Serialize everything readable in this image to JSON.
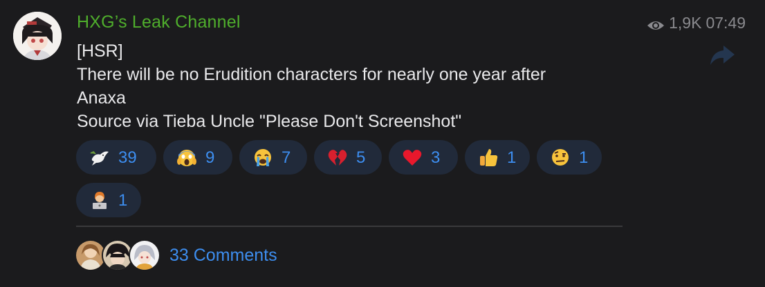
{
  "channel": {
    "name": "HXG’s Leak Channel",
    "views": "1,9K",
    "time": "07:49"
  },
  "message": {
    "lines": [
      "[HSR]",
      "There will be no Erudition characters for nearly one year after",
      "Anaxa",
      "Source via Tieba Uncle \"Please Don't Screenshot\""
    ]
  },
  "reactions": [
    {
      "icon": "dove-icon",
      "count": "39"
    },
    {
      "icon": "screaming-face-icon",
      "count": "9"
    },
    {
      "icon": "crying-face-icon",
      "count": "7"
    },
    {
      "icon": "broken-heart-icon",
      "count": "5"
    },
    {
      "icon": "red-heart-icon",
      "count": "3"
    },
    {
      "icon": "thumbs-up-icon",
      "count": "1"
    },
    {
      "icon": "raised-eyebrow-face-icon",
      "count": "1"
    },
    {
      "icon": "technologist-icon",
      "count": "1"
    }
  ],
  "comments": {
    "label": "33 Comments"
  },
  "colors": {
    "background": "#1b1b1d",
    "channel_name": "#4fae2c",
    "accent_blue": "#3d8ef0",
    "chip_bg": "#212a3a",
    "meta_gray": "#8a8a8e",
    "text": "#e9e9eb"
  }
}
